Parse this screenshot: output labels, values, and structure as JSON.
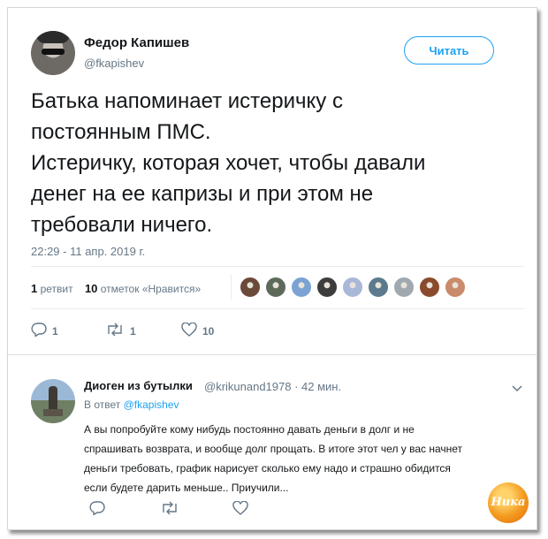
{
  "tweet": {
    "author_name": "Федор Капишев",
    "author_handle": "@fkapishev",
    "follow_label": "Читать",
    "text_lines": [
      "Батька напоминает истеричку с",
      "постоянным ПМС.",
      "Истеричку, которая хочет, чтобы давали",
      "денег на ее капризы и при этом не",
      "требовали ничего."
    ],
    "timestamp": "22:29 - 11 апр. 2019 г.",
    "retweets_count": "1",
    "retweets_label": "ретвит",
    "likes_count": "10",
    "likes_label": "отметок «Нравится»",
    "actions": {
      "replies": "1",
      "retweets": "1",
      "likes": "10"
    },
    "liker_colors": [
      "#6b4a3a",
      "#5d6a5a",
      "#7aa3d4",
      "#3d3d3d",
      "#a9b7d8",
      "#5c7a8e",
      "#a0a8b0",
      "#8a4b2c",
      "#c98b6b"
    ]
  },
  "reply": {
    "author_name": "Диоген из бутылки",
    "meta": "@krikunand1978 · 42 мин.",
    "reply_to_prefix": "В ответ",
    "reply_to_mention": "@fkapishev",
    "text_lines": [
      "А вы попробуйте кому нибудь постоянно давать деньги в долг и не",
      "спрашивать возврата, и вообще долг прощать. В итоге этот чел у вас начнет",
      "деньги требовать, график нарисует сколько ему надо и страшно обидится",
      "если будете дарить меньше.. Приучили..."
    ]
  },
  "watermark": {
    "text": "Ника"
  },
  "colors": {
    "accent": "#1da1f2",
    "muted": "#657786",
    "text": "#14171a"
  }
}
